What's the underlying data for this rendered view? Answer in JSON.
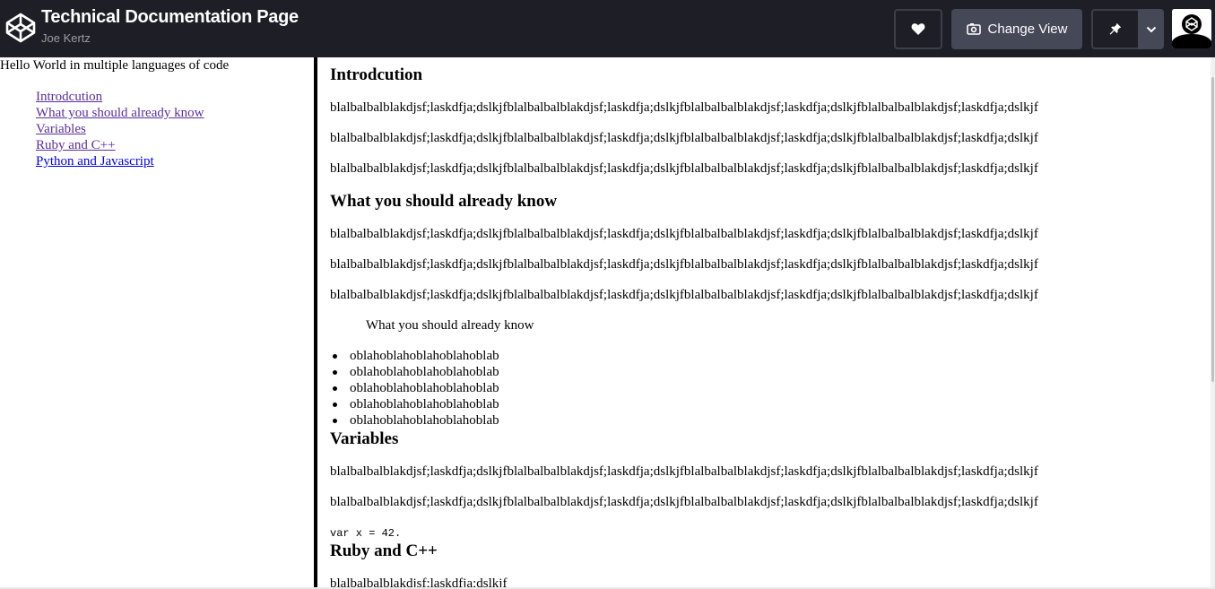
{
  "header": {
    "title": "Technical Documentation Page",
    "author": "Joe Kertz",
    "logo_icon": "codepen-logo-icon",
    "change_view_label": "Change View",
    "icons": {
      "heart": "heart-icon",
      "view": "view-icon",
      "pin": "pin-icon",
      "dropdown": "chevron-down-icon",
      "avatar": "user-avatar"
    }
  },
  "sidebar": {
    "title": "Hello World in multiple languages of code",
    "items": [
      {
        "label": "Introdcution"
      },
      {
        "label": "What you should already know"
      },
      {
        "label": "Variables"
      },
      {
        "label": "Ruby and C++"
      },
      {
        "label": "Python and Javascript"
      }
    ]
  },
  "main": {
    "sections": [
      {
        "heading": "Introdcution",
        "paragraphs": [
          "blalbalbalblakdjsf;laskdfja;dslkjfblalbalbalblakdjsf;laskdfja;dslkjfblalbalbalblakdjsf;laskdfja;dslkjfblalbalbalblakdjsf;laskdfja;dslkjf",
          "blalbalbalblakdjsf;laskdfja;dslkjfblalbalbalblakdjsf;laskdfja;dslkjfblalbalbalblakdjsf;laskdfja;dslkjfblalbalbalblakdjsf;laskdfja;dslkjf",
          "blalbalbalblakdjsf;laskdfja;dslkjfblalbalbalblakdjsf;laskdfja;dslkjfblalbalbalblakdjsf;laskdfja;dslkjfblalbalbalblakdjsf;laskdfja;dslkjf"
        ]
      },
      {
        "heading": "What you should already know",
        "paragraphs": [
          "blalbalbalblakdjsf;laskdfja;dslkjfblalbalbalblakdjsf;laskdfja;dslkjfblalbalbalblakdjsf;laskdfja;dslkjfblalbalbalblakdjsf;laskdfja;dslkjf",
          "blalbalbalblakdjsf;laskdfja;dslkjfblalbalbalblakdjsf;laskdfja;dslkjfblalbalbalblakdjsf;laskdfja;dslkjfblalbalbalblakdjsf;laskdfja;dslkjf",
          "blalbalbalblakdjsf;laskdfja;dslkjfblalbalbalblakdjsf;laskdfja;dslkjfblalbalbalblakdjsf;laskdfja;dslkjfblalbalbalblakdjsf;laskdfja;dslkjf"
        ],
        "quote": "What you should already know",
        "list": [
          "oblahoblahoblahoblahoblab",
          "oblahoblahoblahoblahoblab",
          "oblahoblahoblahoblahoblab",
          "oblahoblahoblahoblahoblab",
          "oblahoblahoblahoblahoblab"
        ]
      },
      {
        "heading": "Variables",
        "paragraphs": [
          "blalbalbalblakdjsf;laskdfja;dslkjfblalbalbalblakdjsf;laskdfja;dslkjfblalbalbalblakdjsf;laskdfja;dslkjfblalbalbalblakdjsf;laskdfja;dslkjf",
          "blalbalbalblakdjsf;laskdfja;dslkjfblalbalbalblakdjsf;laskdfja;dslkjfblalbalbalblakdjsf;laskdfja;dslkjfblalbalbalblakdjsf;laskdfja;dslkjf"
        ],
        "code": "var x = 42."
      },
      {
        "heading": "Ruby and C++",
        "paragraphs": [
          "blalbalbalblakdjsf;laskdfja;dslkjf"
        ]
      }
    ]
  },
  "colors": {
    "topbar_bg": "#1e1f26",
    "button_bg": "#444857",
    "visited_link": "#5a2f9e",
    "link": "#0000ee"
  }
}
